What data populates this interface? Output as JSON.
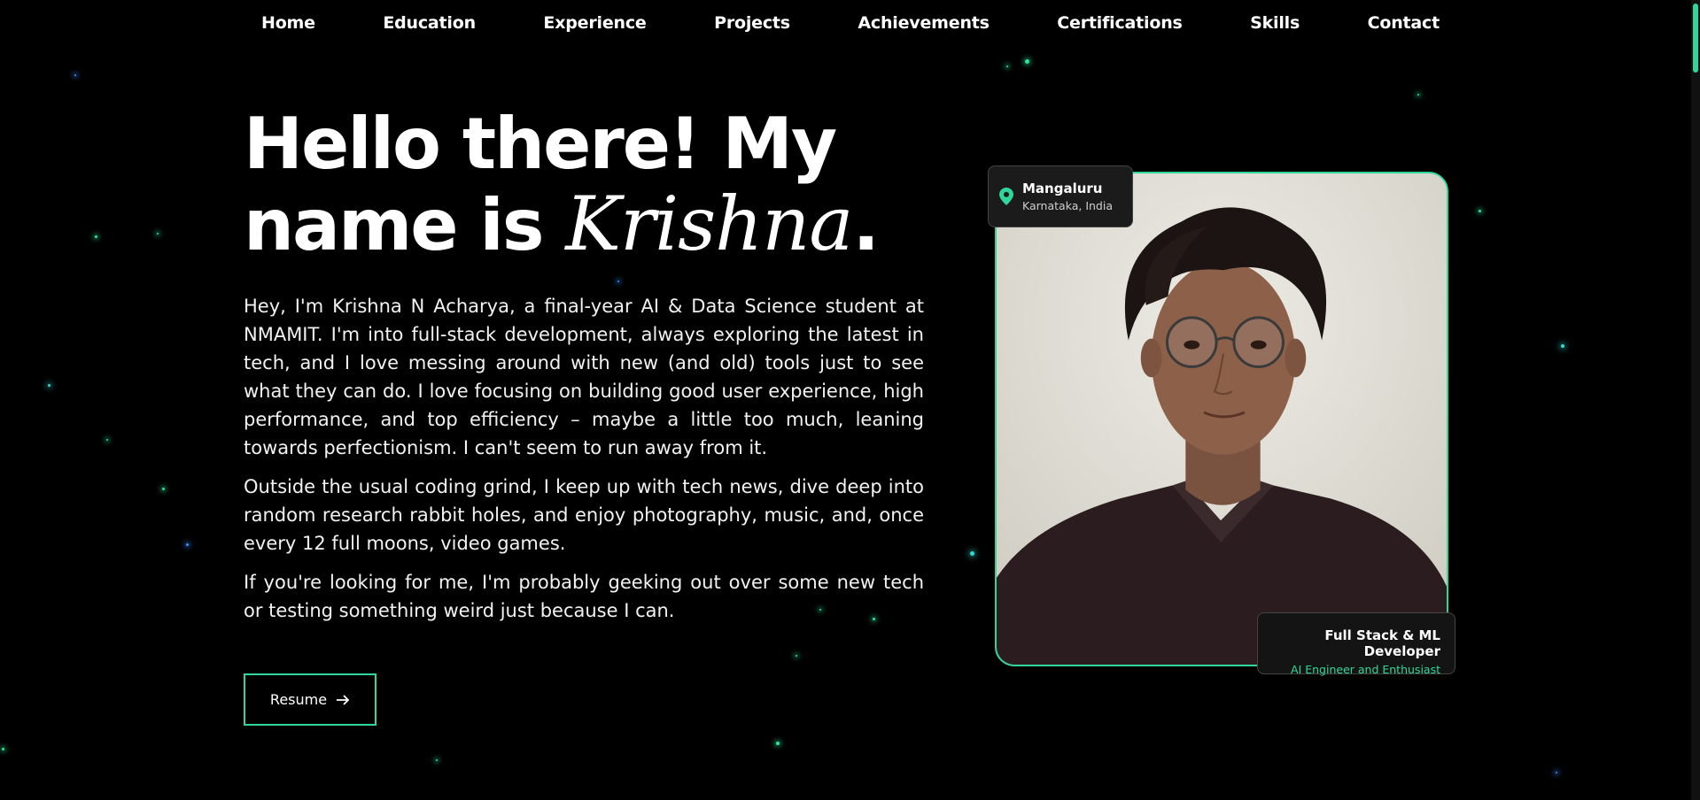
{
  "nav": {
    "items": [
      "Home",
      "Education",
      "Experience",
      "Projects",
      "Achievements",
      "Certifications",
      "Skills",
      "Contact"
    ]
  },
  "hero": {
    "title_part1": "Hello there! My",
    "title_part2": "name is ",
    "title_name": "Krishna",
    "title_end": ".",
    "paragraphs": [
      "Hey, I'm Krishna N Acharya, a final-year AI & Data Science student at NMAMIT. I'm into full-stack development, always exploring the latest in tech, and I love messing around with new (and old) tools just to see what they can do. I love focusing on building good user experience, high performance, and top efficiency – maybe a little too much, leaning towards perfectionism. I can't seem to run away from it.",
      "Outside the usual coding grind, I keep up with tech news, dive deep into random research rabbit holes, and enjoy photography, music, and, once every 12 full moons, video games.",
      "If you're looking for me, I'm probably geeking out over some new tech or testing something weird just because I can."
    ],
    "resume_label": "Resume",
    "resume_icon": "arrow-right-icon"
  },
  "profile": {
    "location_city": "Mangaluru",
    "location_region": "Karnataka, India",
    "location_icon": "map-pin-icon",
    "role_title": "Full Stack & ML Developer",
    "role_subtitle": "AI Engineer and Enthusiast"
  },
  "colors": {
    "accent": "#2fd79a",
    "background": "#000000"
  }
}
